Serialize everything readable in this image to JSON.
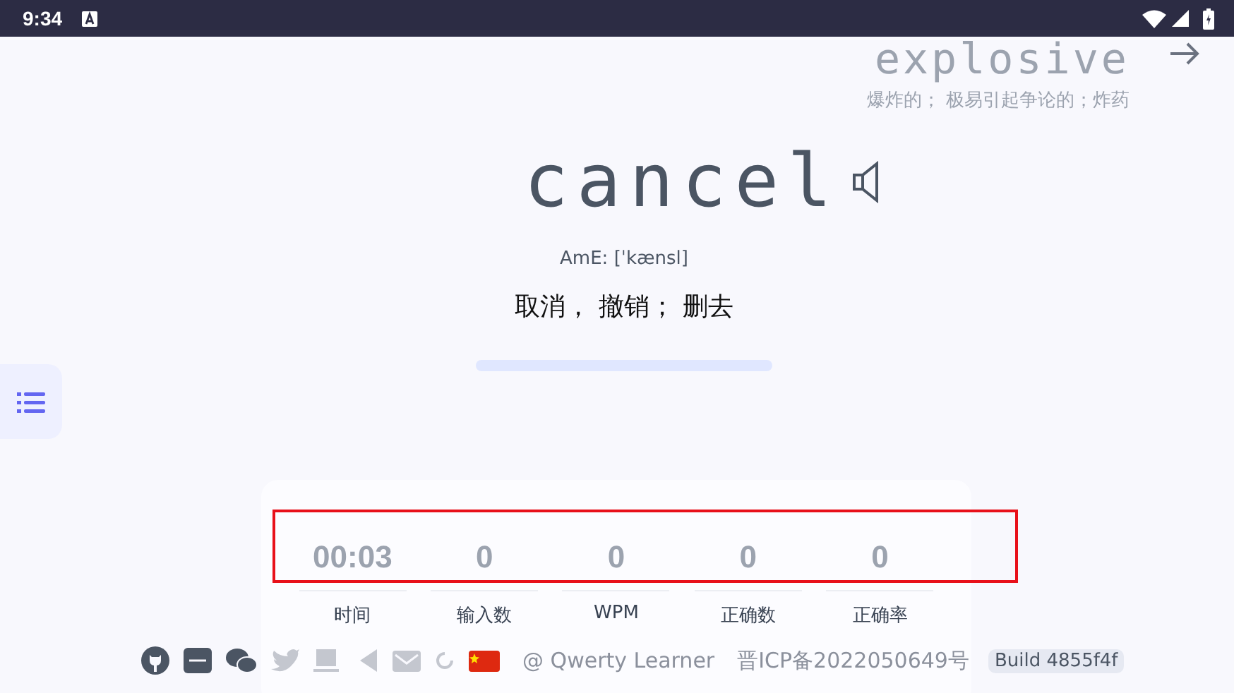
{
  "status_bar": {
    "time": "9:34"
  },
  "next_word": {
    "word": "explosive",
    "translation": "爆炸的； 极易引起争论的；炸药"
  },
  "word": {
    "text": "cancel",
    "phonetic": "AmE: [ˈkænsl]",
    "translation": "取消， 撤销； 删去",
    "progress": {
      "level": 0
    }
  },
  "stats": [
    {
      "value": "00:03",
      "label": "时间"
    },
    {
      "value": "0",
      "label": "输入数"
    },
    {
      "value": "0",
      "label": "WPM"
    },
    {
      "value": "0",
      "label": "正确数"
    },
    {
      "value": "0",
      "label": "正确率"
    }
  ],
  "footer": {
    "credit": "@ Qwerty Learner",
    "icp": "晋ICP备2022050649号",
    "build": "Build 4855f4f"
  }
}
